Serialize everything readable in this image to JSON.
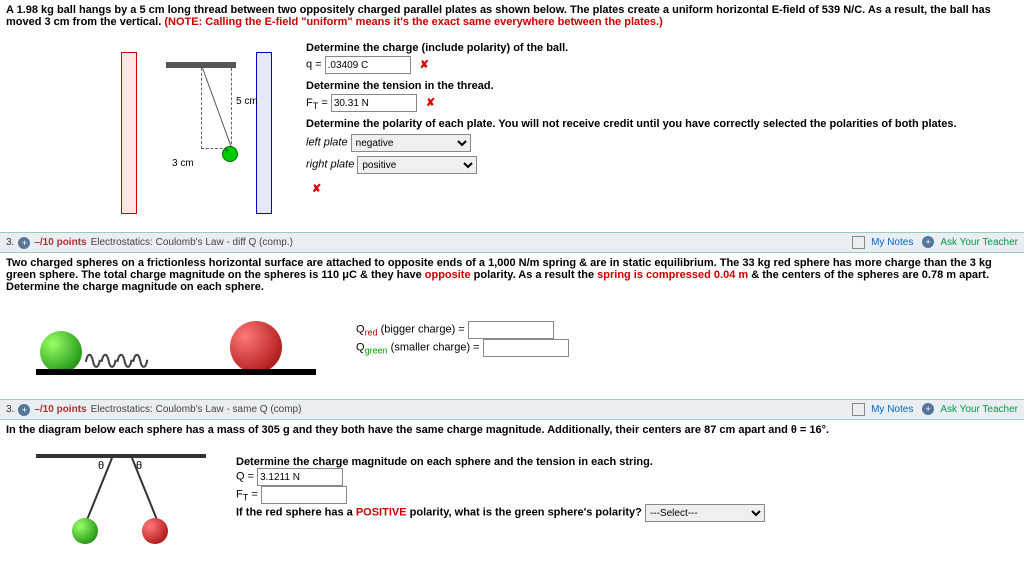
{
  "q1": {
    "prompt_a": "A 1.98 kg ball hangs by a 5 cm long thread between two oppositely charged parallel plates as shown below. The plates create a uniform horizontal E-field of 539 N/C. As a result, the ball has moved 3 cm from the vertical. ",
    "note": "(NOTE: Calling the E-field \"uniform\" means it's the exact same everywhere between the plates.)",
    "diagram": {
      "l5cm": "5 cm",
      "l3cm": "3 cm"
    },
    "p1": {
      "label": "Determine the charge (include polarity) of the ball.",
      "sym": "q = ",
      "val": ".03409 C",
      "unit": ""
    },
    "p2": {
      "label": "Determine the tension in the thread.",
      "sym": "F_T = ",
      "val": "30.31 N",
      "unit": ""
    },
    "p3": {
      "label": "Determine the polarity of each plate. You will not receive credit until you have correctly selected the polarities of both plates.",
      "left_lbl": "left plate",
      "left_val": "negative",
      "right_lbl": "right plate",
      "right_val": "positive"
    },
    "wrong": "✘"
  },
  "q2": {
    "num": "3.",
    "pts": "–/10 points",
    "src": "Electrostatics: Coulomb's Law - diff Q (comp.)",
    "mynotes": "My Notes",
    "ask": "Ask Your Teacher",
    "text_a": "Two charged spheres on a frictionless horizontal surface are attached to opposite ends of a 1,000 N/m spring & are in static equilibrium. The 33 kg red sphere has more charge than the 3 kg green sphere. The total charge magnitude on the spheres is 110 μC & they have ",
    "opp": "opposite",
    "text_b": " polarity. As a result the ",
    "spring": "spring is compressed 0.04 m",
    "text_c": " & the centers of the spheres are 0.78 m apart. Determine the charge magnitude on each sphere.",
    "f1": "Q_red (bigger charge) = ",
    "f2": "Q_green (smaller charge) = "
  },
  "q3": {
    "num": "3.",
    "pts": "–/10 points",
    "src": "Electrostatics: Coulomb's Law - same Q (comp)",
    "mynotes": "My Notes",
    "ask": "Ask Your Teacher",
    "text": "In the diagram below each sphere has a mass of 305 g and they both have the same charge magnitude. Additionally, their centers are 87 cm apart and θ = 16°.",
    "theta": "θ",
    "p1": "Determine the charge magnitude on each sphere and the tension in each string.",
    "q_sym": "Q = ",
    "q_val": "3.1211 N",
    "ft_sym": "F_T = ",
    "p2_a": "If the red sphere has a ",
    "pos": "POSITIVE",
    "p2_b": " polarity, what is the green sphere's polarity? ",
    "sel": "---Select---"
  }
}
